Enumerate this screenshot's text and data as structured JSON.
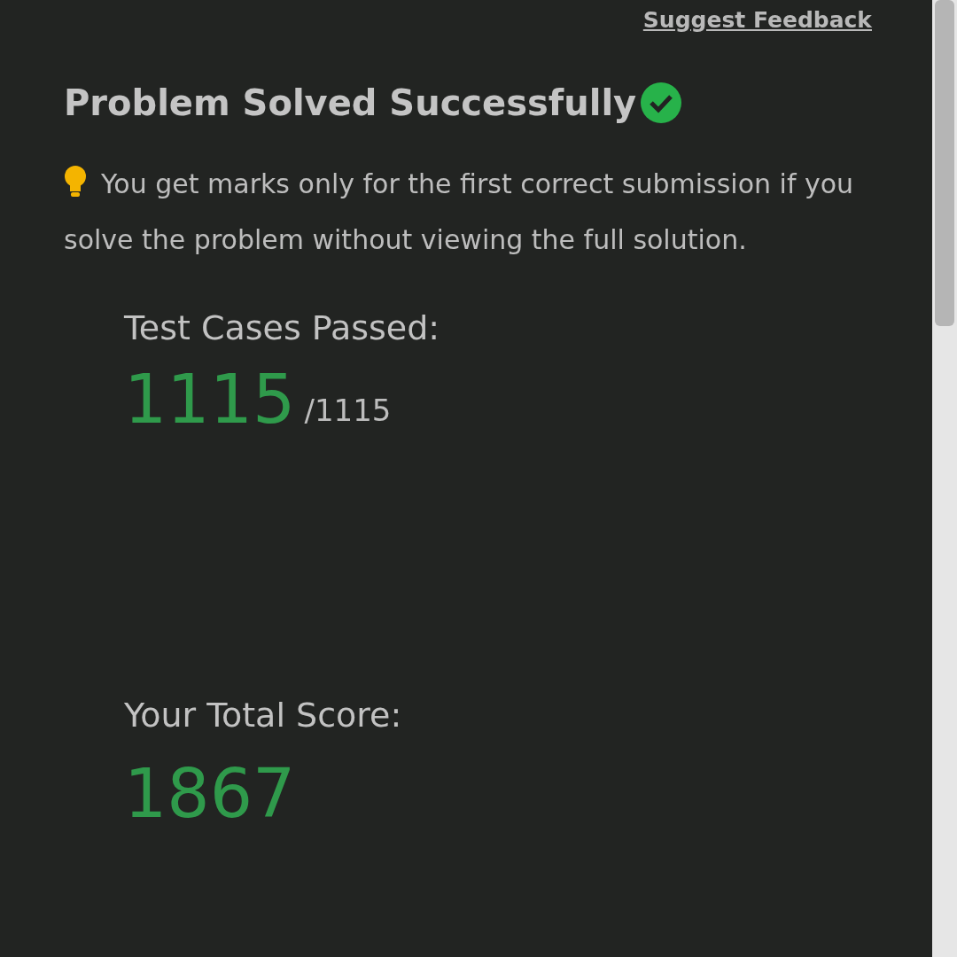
{
  "feedback_link": "Suggest Feedback",
  "title": "Problem Solved Successfully",
  "note": "You get marks only for the first correct submission if you solve the problem without viewing the full solution.",
  "test_cases": {
    "label": "Test Cases Passed:",
    "passed": "1115",
    "total": "/1115"
  },
  "score": {
    "label": "Your Total Score:",
    "value": "1867"
  }
}
